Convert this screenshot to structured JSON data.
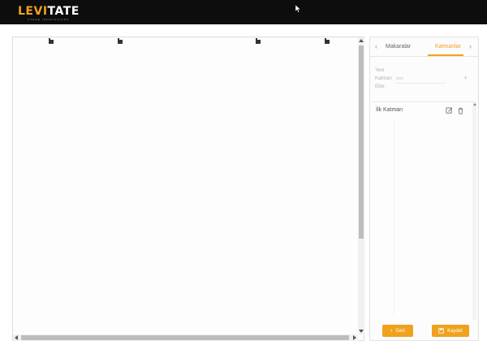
{
  "brand": {
    "levi": "LEVI",
    "tate": "TATE",
    "tagline": "STAGE INNOVATIONS"
  },
  "panel": {
    "tabs": [
      {
        "label": "Makaralar",
        "active": false
      },
      {
        "label": "Katmanlar",
        "active": true
      }
    ],
    "add_layer": {
      "label": "Yeni Katman Ekle",
      "placeholder": "İsim"
    },
    "layers": [
      {
        "name": "İlk Katman"
      }
    ]
  },
  "footer": {
    "back_label": "Geri",
    "save_label": "Kaydet"
  },
  "colors": {
    "accent": "#f0a21c",
    "topbar": "#0d0d0d"
  },
  "icons": {
    "cursor": "arrow-cursor-icon",
    "tab_prev": "chevron-left-icon",
    "tab_next": "chevron-right-icon",
    "add": "plus-icon",
    "edit": "edit-icon",
    "delete": "trash-icon",
    "back": "chevron-left-icon",
    "save": "save-icon",
    "reel": "reel-marker-icon"
  }
}
